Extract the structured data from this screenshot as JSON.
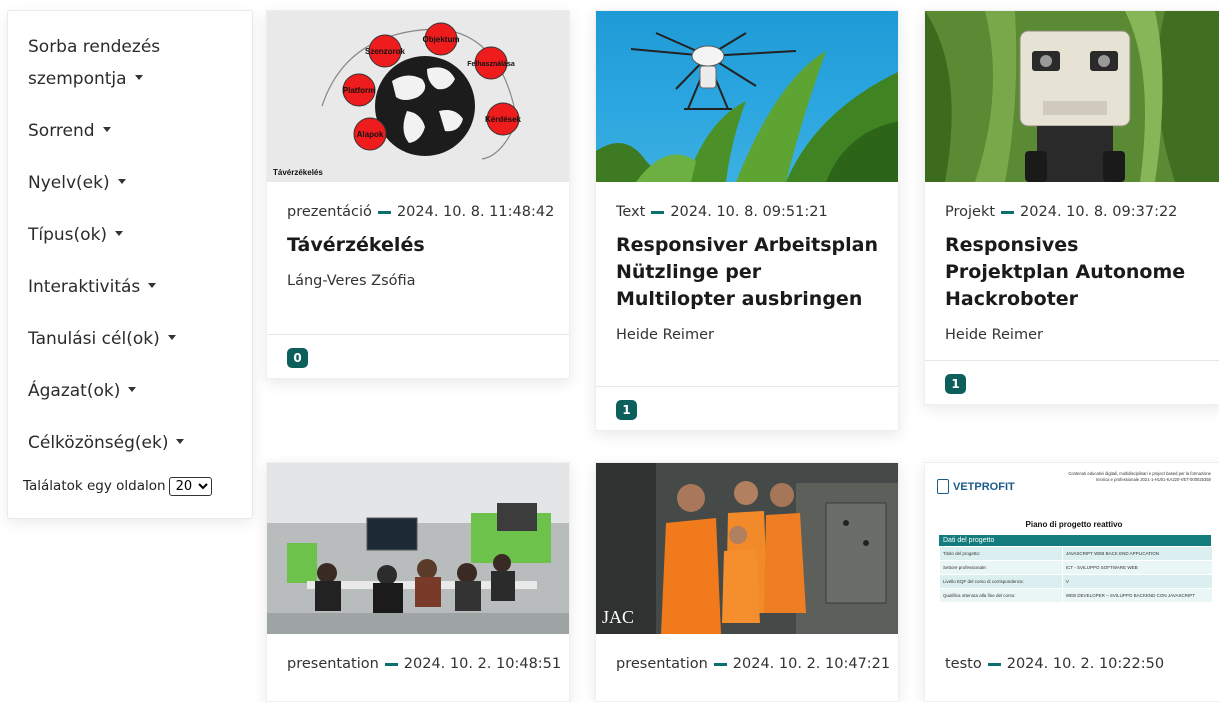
{
  "sidebar": {
    "filters": [
      {
        "label": "Sorba rendezés szempontja"
      },
      {
        "label": "Sorrend"
      },
      {
        "label": "Nyelv(ek)"
      },
      {
        "label": "Típus(ok)"
      },
      {
        "label": "Interaktivitás"
      },
      {
        "label": "Tanulási cél(ok)"
      },
      {
        "label": "Ágazat(ok)"
      },
      {
        "label": "Célközönség(ek)"
      }
    ],
    "per_page_label": "Találatok egy oldalon",
    "per_page_value": "20"
  },
  "cards": [
    {
      "type": "prezentáció",
      "date": "2024. 10. 8. 11:48:42",
      "title": "Távérzékelés",
      "author": "Láng-Veres Zsófia",
      "count": "0",
      "thumb": {
        "caption": "Távérzékelés",
        "bubbles": [
          "Objektum",
          "Szenzorok",
          "Felhasználása",
          "Platform",
          "Kérdések",
          "Alapok"
        ]
      }
    },
    {
      "type": "Text",
      "date": "2024. 10. 8. 09:51:21",
      "title": "Responsiver Arbeitsplan Nützlinge per Multilopter ausbringen",
      "author": "Heide Reimer",
      "count": "1"
    },
    {
      "type": "Projekt",
      "date": "2024. 10. 8. 09:37:22",
      "title": "Responsives Projektplan Autonome Hackroboter",
      "author": "Heide Reimer",
      "count": "1"
    },
    {
      "type": "presentation",
      "date": "2024. 10. 2. 10:48:51"
    },
    {
      "type": "presentation",
      "date": "2024. 10. 2. 10:47:21",
      "thumb": {
        "logo": "JAC"
      }
    },
    {
      "type": "testo",
      "date": "2024. 10. 2. 10:22:50",
      "thumb": {
        "brand": "VETPROFIT",
        "header_right": "Contenuti educativi digitali, multidisciplinari e project based per la formazione tecnica e professionale 2021-1-HU01-KA220-VET-000025350",
        "doc_title": "Piano di progetto reattivo",
        "section": "Dati del progetto",
        "rows": [
          [
            "Titolo del progetto:",
            "JAVASCRIPT WEB BACK END APPLICATION"
          ],
          [
            "Settore professionale:",
            "ICT - SVILUPPO SOFTWARE WEB"
          ],
          [
            "Livello EQF del corso di corrispondenza:",
            "V"
          ],
          [
            "Qualifica ottenuta alla fine del corso:",
            "WEB DEVELOPER – SVILUPPO BACKEND CON JAVASCRIPT"
          ]
        ]
      }
    }
  ]
}
